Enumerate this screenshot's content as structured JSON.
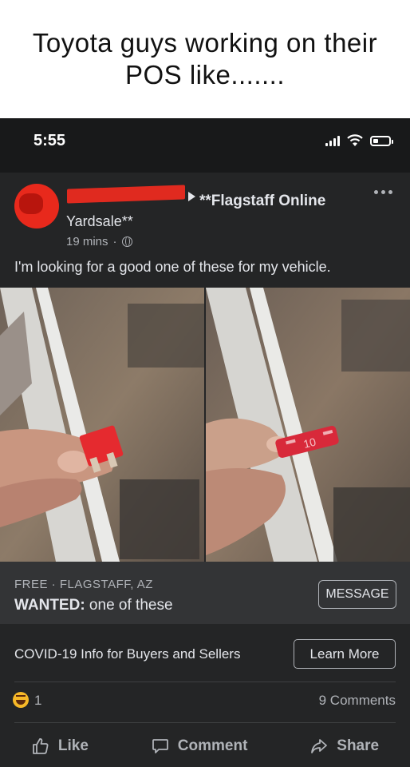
{
  "caption": "Toyota guys working on their POS like.......",
  "status_bar": {
    "time": "5:55"
  },
  "post": {
    "group_name_line1": "**Flagstaff Online",
    "group_name_line2": "Yardsale**",
    "time_ago": "19 mins",
    "text": "I'm looking for a good one of these for my vehicle.",
    "fuse_label": "10"
  },
  "listing": {
    "meta": "FREE · FLAGSTAFF, AZ",
    "title_bold": "WANTED:",
    "title_rest": " one of these",
    "message_button": "MESSAGE"
  },
  "covid": {
    "text": "COVID-19 Info for Buyers and Sellers",
    "button": "Learn More"
  },
  "reactions": {
    "count": "1",
    "comments": "9 Comments"
  },
  "actions": {
    "like": "Like",
    "comment": "Comment",
    "share": "Share"
  },
  "icons": [
    "signal-icon",
    "wifi-icon",
    "battery-icon",
    "more-icon",
    "globe-icon",
    "haha-icon",
    "like-icon",
    "comment-icon",
    "share-icon"
  ]
}
